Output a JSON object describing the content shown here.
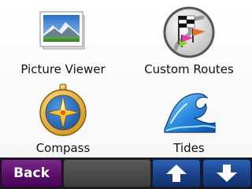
{
  "menu": {
    "items": [
      {
        "label": "Picture Viewer",
        "icon": "picture-viewer-icon"
      },
      {
        "label": "Custom Routes",
        "icon": "custom-routes-icon"
      },
      {
        "label": "Compass",
        "icon": "compass-icon"
      },
      {
        "label": "Tides",
        "icon": "tides-icon"
      }
    ]
  },
  "bottom_bar": {
    "back_label": "Back",
    "up_icon": "arrow-up-icon",
    "down_icon": "arrow-down-icon"
  },
  "colors": {
    "back_button": "#5a0f6a",
    "arrow_buttons": "#1a3f85",
    "bar_background": "#1a1a1a"
  }
}
